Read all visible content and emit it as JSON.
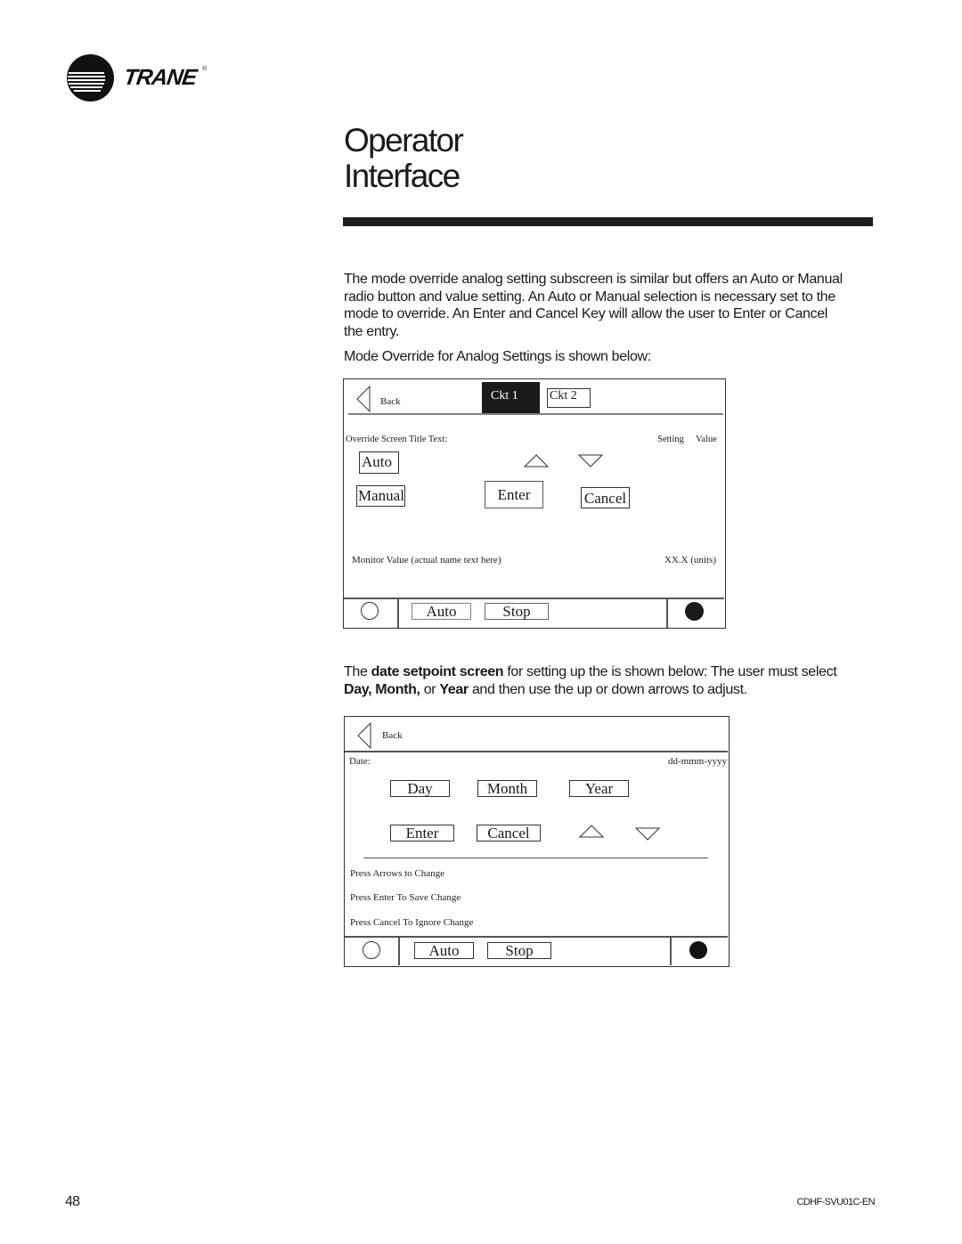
{
  "brand": {
    "name": "TRANE",
    "registered_mark": "®",
    "logo_icon": "trane-circle-logo-icon"
  },
  "page": {
    "title_line1": "Operator",
    "title_line2": "Interface",
    "page_number": "48",
    "doc_code": "CDHF-SVU01C-EN"
  },
  "intro": {
    "paragraph": "The mode override analog setting subscreen is similar but offers an Auto or Manual radio button and value setting. An Auto or Manual selection is necessary set to the mode to override. An Enter and Cancel Key will allow the user to Enter or Cancel the entry.",
    "caption": "Mode Override for Analog Settings is shown below:"
  },
  "screen1": {
    "back_label": "Back",
    "back_icon": "back-triangle-icon",
    "tabs": [
      {
        "label": "Ckt 1",
        "selected": true
      },
      {
        "label": "Ckt 2",
        "selected": false
      }
    ],
    "header_rule_color": "#8c7a8c",
    "override_title": "Override Screen Title Text:",
    "setting_label": "Setting",
    "value_label": "Value",
    "auto_label": "Auto",
    "manual_label": "Manual",
    "enter_label": "Enter",
    "cancel_label": "Cancel",
    "up_icon": "up-arrow-icon",
    "down_icon": "down-arrow-icon",
    "monitor_label": "Monitor Value (actual name text here)",
    "monitor_value": "XX.X (units)",
    "footer": {
      "auto_label": "Auto",
      "stop_label": "Stop",
      "left_indicator": "empty-circle-icon",
      "right_indicator": "filled-circle-icon"
    }
  },
  "date_section": {
    "text_prefix": "The ",
    "text_bold1": "date setpoint screen",
    "text_mid1": " for setting up the is shown below: The user must select ",
    "text_bold2": "Day, Month,",
    "text_mid2": " or ",
    "text_bold3": "Year",
    "text_suffix": " and then use the up or down arrows to adjust."
  },
  "screen2": {
    "back_label": "Back",
    "date_label": "Date:",
    "date_format": "dd-mmm-yyyy",
    "day_label": "Day",
    "month_label": "Month",
    "year_label": "Year",
    "enter_label": "Enter",
    "cancel_label": "Cancel",
    "instructions": [
      "Press Arrows to Change",
      "Press Enter To Save Change",
      "Press Cancel To Ignore Change"
    ],
    "footer": {
      "auto_label": "Auto",
      "stop_label": "Stop"
    }
  }
}
